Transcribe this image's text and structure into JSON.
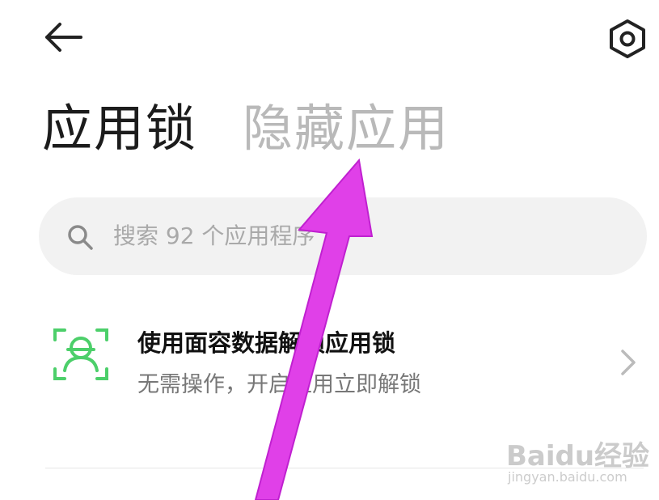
{
  "header": {
    "back_icon": "arrow-left-icon",
    "settings_icon": "hexagon-gear-icon"
  },
  "tabs": [
    {
      "label": "应用锁",
      "active": true
    },
    {
      "label": "隐藏应用",
      "active": false
    }
  ],
  "search": {
    "icon": "search-icon",
    "placeholder": "搜索 92 个应用程序"
  },
  "face_unlock": {
    "icon": "face-scan-icon",
    "title": "使用面容数据解锁应用锁",
    "subtitle": "无需操作，开启应用立即解锁",
    "chevron_icon": "chevron-right-icon"
  },
  "annotation": {
    "arrow_color": "#e040e8"
  },
  "watermark": {
    "logo": "Baidu经验",
    "url": "jingyan.baidu.com"
  },
  "colors": {
    "face_icon": "#4ccf6a",
    "search_bg": "#f2f2f2",
    "inactive_tab": "#b9b9b9"
  }
}
